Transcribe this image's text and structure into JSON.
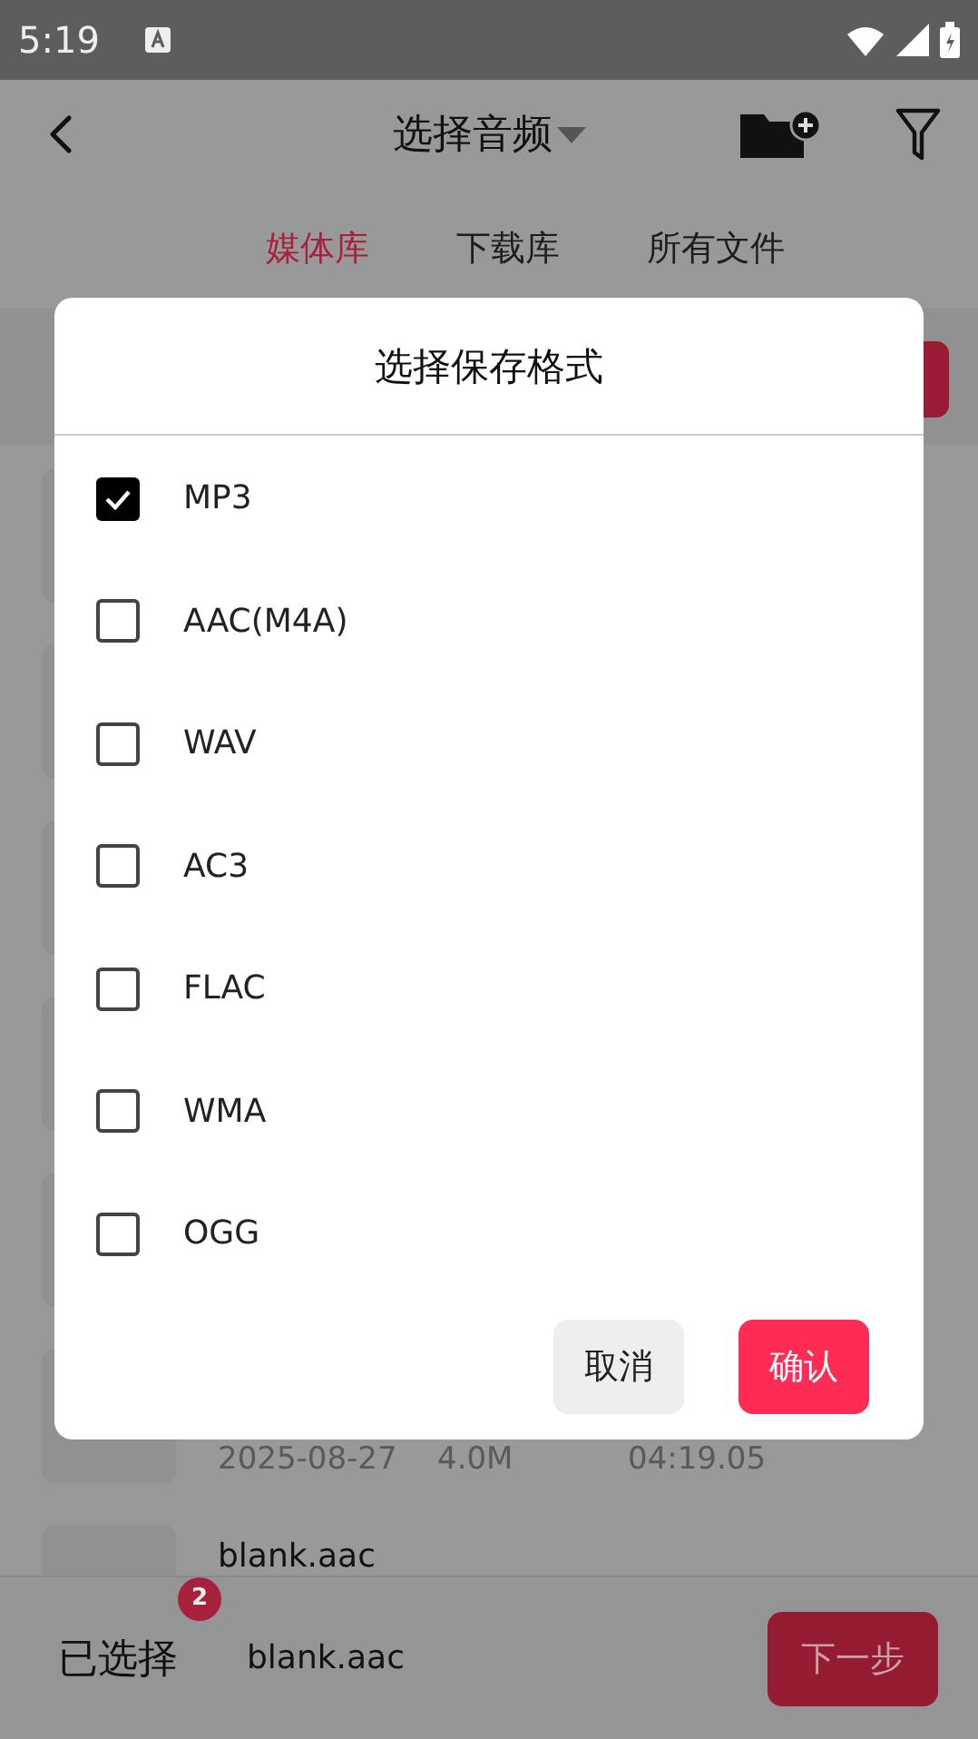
{
  "status_bar": {
    "time": "5:19"
  },
  "header": {
    "title": "选择音频"
  },
  "tabs": [
    {
      "label": "媒体库",
      "selected": true
    },
    {
      "label": "下载库",
      "selected": false
    },
    {
      "label": "所有文件",
      "selected": false
    }
  ],
  "list": {
    "rows": [
      {
        "date": "2025-08-27",
        "size": "4.0M",
        "duration": "04:19.05"
      },
      {
        "name": "blank.aac"
      }
    ]
  },
  "bottom_bar": {
    "label": "已选择",
    "count": "2",
    "file": "blank.aac",
    "next_button": "下一步"
  },
  "dialog": {
    "title": "选择保存格式",
    "options": [
      {
        "label": "MP3",
        "checked": true
      },
      {
        "label": "AAC(M4A)",
        "checked": false
      },
      {
        "label": "WAV",
        "checked": false
      },
      {
        "label": "AC3",
        "checked": false
      },
      {
        "label": "FLAC",
        "checked": false
      },
      {
        "label": "WMA",
        "checked": false
      },
      {
        "label": "OGG",
        "checked": false
      }
    ],
    "buttons": [
      {
        "label": "取消",
        "kind": "secondary"
      },
      {
        "label": "确认",
        "kind": "primary"
      }
    ]
  }
}
